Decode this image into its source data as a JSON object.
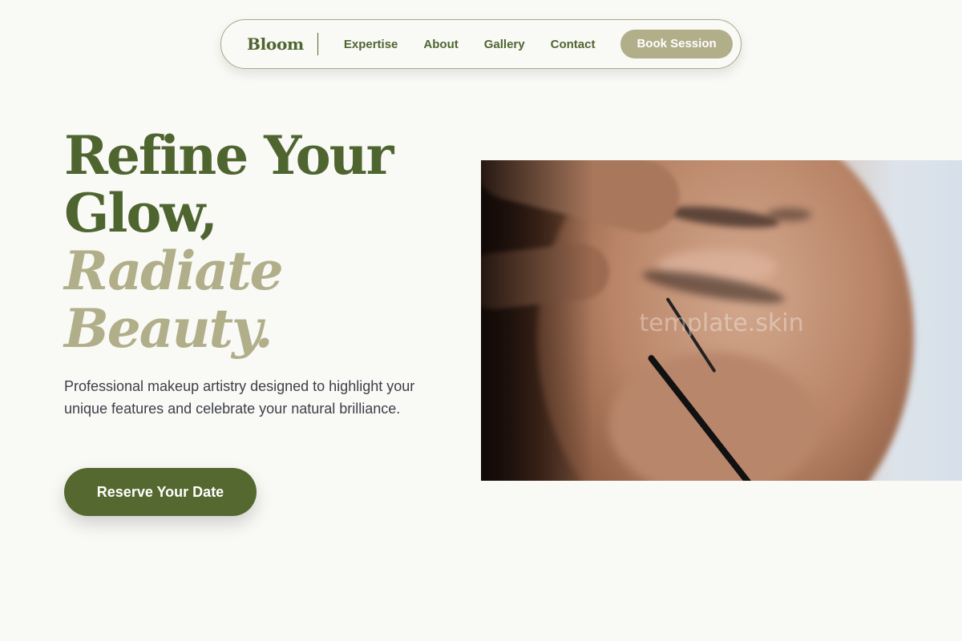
{
  "nav": {
    "brand": "Bloom",
    "links": [
      "Expertise",
      "About",
      "Gallery",
      "Contact"
    ],
    "cta": "Book Session"
  },
  "hero": {
    "headline_line1": "Refine Your",
    "headline_line2": "Glow,",
    "headline_line3": "Radiate",
    "headline_line4": "Beauty.",
    "subtitle": "Professional makeup artistry designed to highlight your unique features and celebrate your natural brilliance.",
    "cta": "Reserve Your Date",
    "image_watermark": "template.skin"
  },
  "colors": {
    "background": "#f9f9f6",
    "primary_green": "#54682f",
    "accent_sage": "#b1ae8a",
    "text_dark": "#3d4048"
  }
}
